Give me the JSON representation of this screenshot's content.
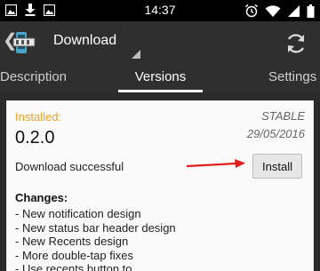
{
  "status_bar": {
    "time": "14:37",
    "left_icons": [
      "image-notification-icon",
      "download-notification-icon",
      "image-notification-icon"
    ],
    "right_icons": [
      "alarm-icon",
      "wifi-icon",
      "signal-icon",
      "battery-icon"
    ]
  },
  "action_bar": {
    "title": "Download"
  },
  "tabs": [
    {
      "label": "Description"
    },
    {
      "label": "Versions"
    },
    {
      "label": "Settings"
    }
  ],
  "card": {
    "installed_label": "Installed:",
    "channel": "STABLE",
    "date": "29/05/2016",
    "version": "0.2.0",
    "status": "Download successful",
    "install_label": "Install",
    "changes_title": "Changes:",
    "changes": [
      "- New notification design",
      "- New status bar header design",
      "- New Recents design",
      "- More double-tap fixes",
      "- Use recents button to"
    ]
  },
  "colors": {
    "installed_accent": "#f0a020",
    "annotation_arrow": "#e02020"
  }
}
